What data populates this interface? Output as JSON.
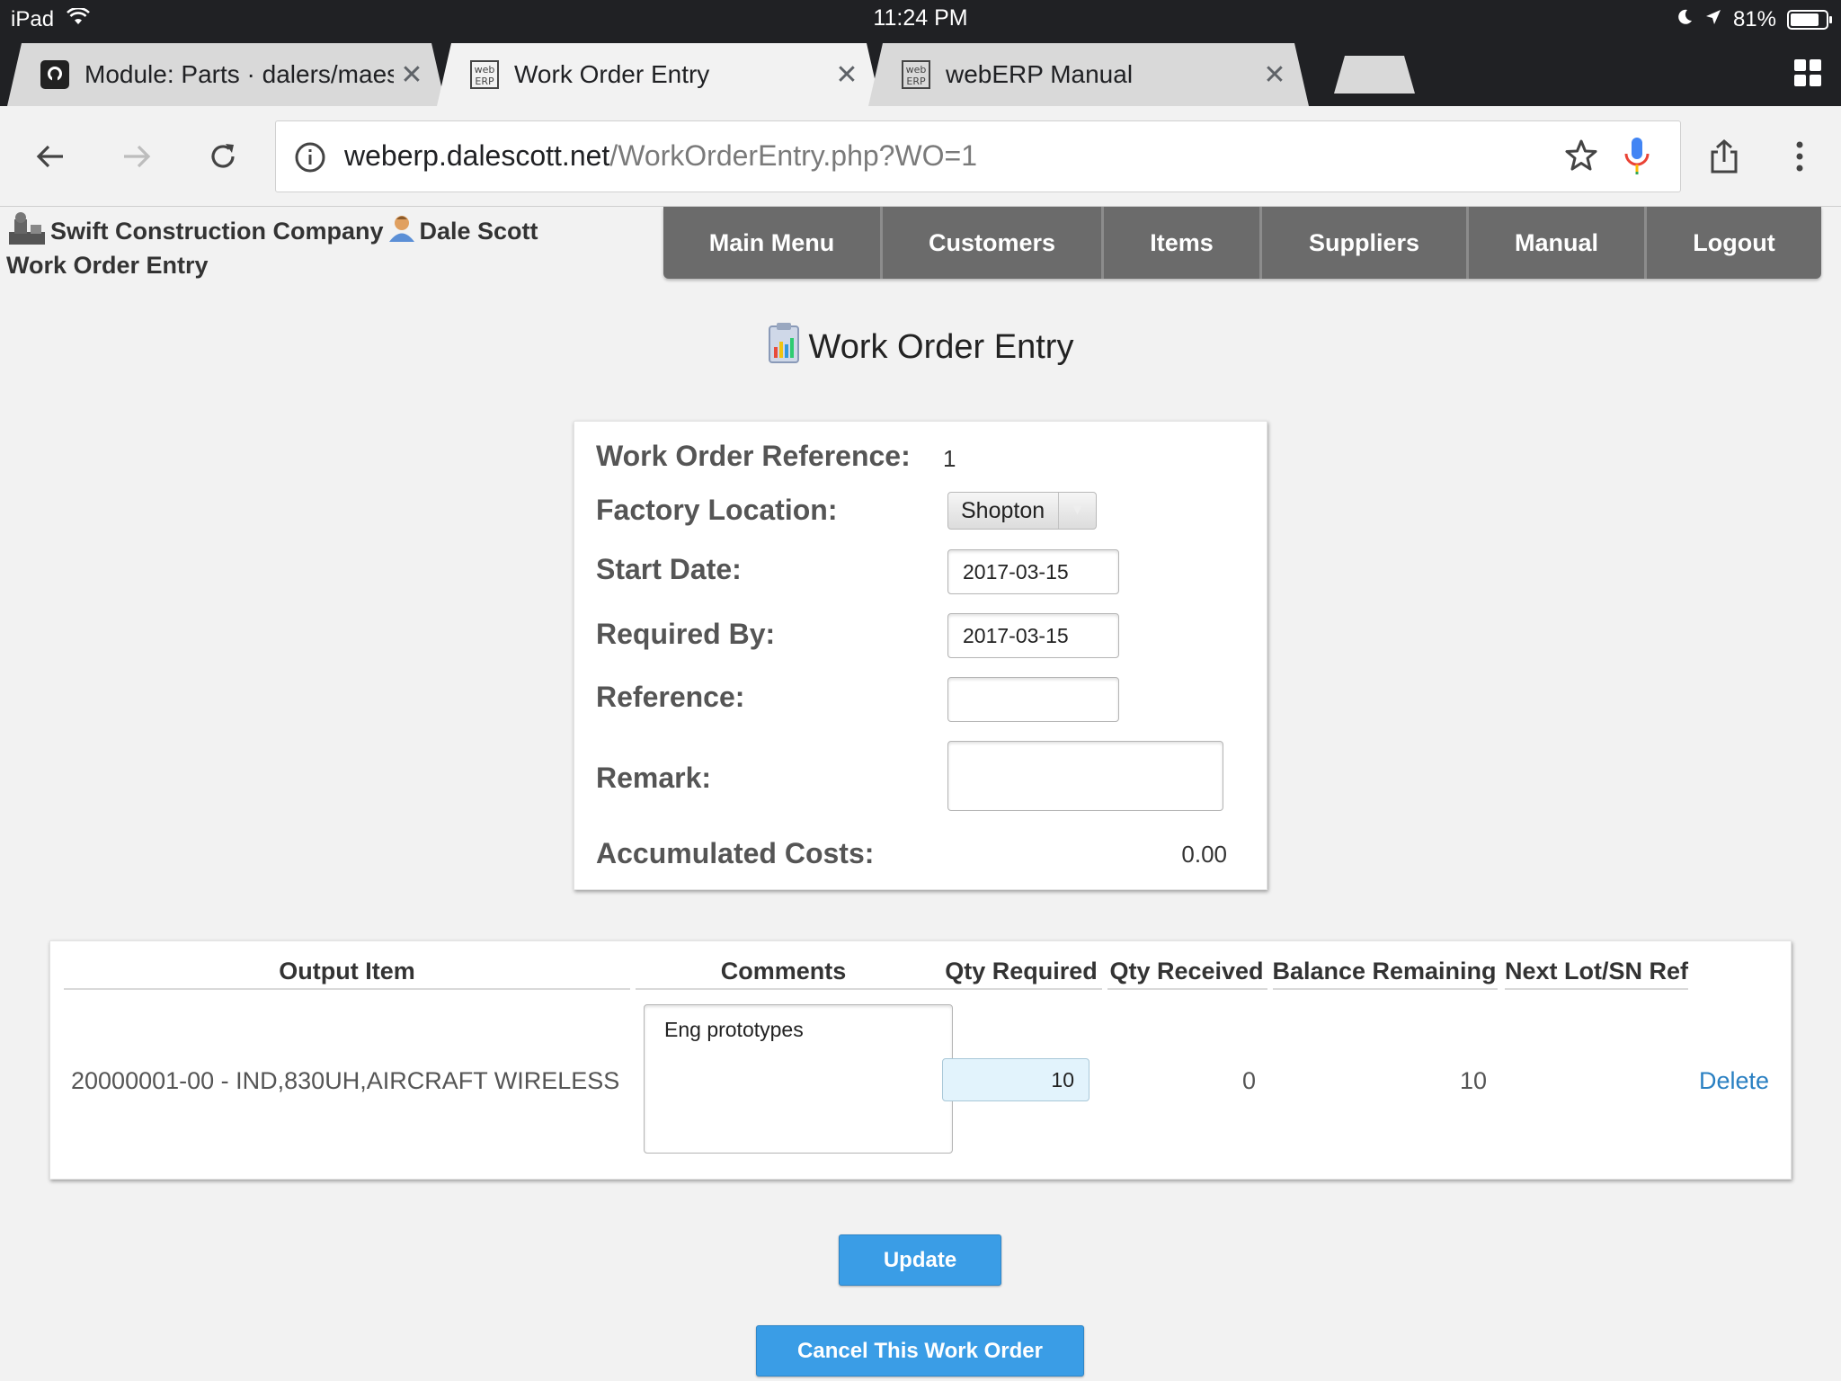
{
  "status_bar": {
    "device": "iPad",
    "time": "11:24 PM",
    "battery": "81%",
    "battery_level": 0.81
  },
  "tabs": [
    {
      "title": "Module: Parts · dalers/maes",
      "favicon": "github-icon",
      "active": false
    },
    {
      "title": "Work Order Entry",
      "favicon": "weberp-icon",
      "active": true
    },
    {
      "title": "webERP Manual",
      "favicon": "weberp-icon",
      "active": false
    }
  ],
  "address_bar": {
    "domain": "weberp.dalescott.net",
    "path": "/WorkOrderEntry.php?WO=1"
  },
  "header": {
    "company": "Swift Construction Company",
    "user": "Dale Scott",
    "page": "Work Order Entry"
  },
  "menu": [
    "Main Menu",
    "Customers",
    "Items",
    "Suppliers",
    "Manual",
    "Logout"
  ],
  "page_title": "Work Order Entry",
  "form": {
    "wo_ref_label": "Work Order Reference:",
    "wo_ref_value": "1",
    "location_label": "Factory Location:",
    "location_value": "Shopton",
    "start_label": "Start Date:",
    "start_value": "2017-03-15",
    "required_label": "Required By:",
    "required_value": "2017-03-15",
    "reference_label": "Reference:",
    "reference_value": "",
    "remark_label": "Remark:",
    "remark_value": "",
    "costs_label": "Accumulated Costs:",
    "costs_value": "0.00"
  },
  "items_table": {
    "headers": [
      "Output Item",
      "Comments",
      "Qty Required",
      "Qty Received",
      "Balance Remaining",
      "Next Lot/SN Ref"
    ],
    "row": {
      "item": "20000001-00 - IND,830UH,AIRCRAFT WIRELESS",
      "comments": "Eng prototypes",
      "qty_required": "10",
      "qty_received": "0",
      "balance": "10",
      "delete": "Delete"
    }
  },
  "buttons": {
    "update": "Update",
    "cancel": "Cancel This Work Order"
  }
}
